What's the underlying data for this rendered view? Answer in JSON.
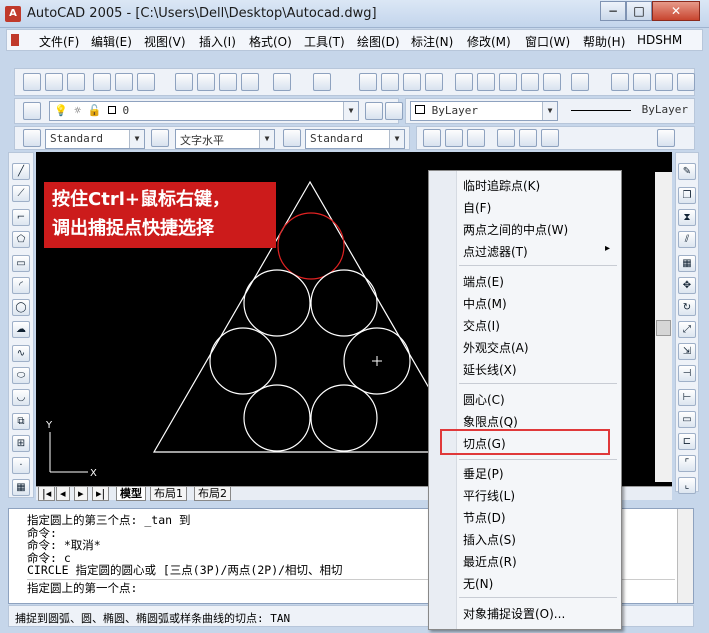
{
  "window": {
    "title": "AutoCAD 2005 - [C:\\Users\\Dell\\Desktop\\Autocad.dwg]",
    "min": "−",
    "max": "□",
    "close": "✕"
  },
  "menu": [
    "文件(F)",
    "编辑(E)",
    "视图(V)",
    "插入(I)",
    "格式(O)",
    "工具(T)",
    "绘图(D)",
    "标注(N)",
    "修改(M)",
    "窗口(W)",
    "帮助(H)",
    "HDSHM"
  ],
  "layer_combo": "0",
  "bylayer_color": "ByLayer",
  "bylayer_linetype": "ByLayer",
  "text_style": "Standard",
  "text_style2": "文字水平",
  "dim_style": "Standard",
  "annotation": {
    "line1": "按住Ctrl+鼠标右键，",
    "line2": "调出捕捉点快捷选择"
  },
  "ucs": {
    "x": "X",
    "y": "Y"
  },
  "tabs": [
    "模型",
    "布局1",
    "布局2"
  ],
  "command_lines": [
    "指定圆上的第三个点: _tan 到",
    "命令:",
    "命令: *取消*",
    "命令: c",
    "CIRCLE 指定圆的圆心或 [三点(3P)/两点(2P)/相切、相切",
    "指定圆上的第一个点:"
  ],
  "status": "捕捉到圆弧、圆、椭圆、椭圆弧或样条曲线的切点: TAN",
  "context_menu": {
    "g1": [
      "临时追踪点(K)",
      "自(F)",
      "两点之间的中点(W)",
      "点过滤器(T)"
    ],
    "g2": [
      "端点(E)",
      "中点(M)",
      "交点(I)",
      "外观交点(A)",
      "延长线(X)"
    ],
    "g3": [
      "圆心(C)",
      "象限点(Q)",
      "切点(G)"
    ],
    "g4": [
      "垂足(P)",
      "平行线(L)",
      "节点(D)",
      "插入点(S)",
      "最近点(R)",
      "无(N)"
    ],
    "g5": [
      "对象捕捉设置(O)..."
    ],
    "submenu_arrow": "▸"
  },
  "colors": {
    "annotation_bg": "#cc1b1b",
    "highlight": "#e0393a",
    "canvas": "#000000"
  }
}
